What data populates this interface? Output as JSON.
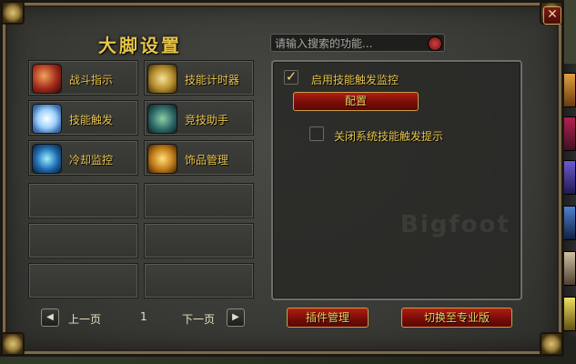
{
  "window": {
    "title": "大脚设置",
    "close_label": "✕"
  },
  "search": {
    "placeholder": "请输入搜索的功能..."
  },
  "modules": [
    {
      "label": "战斗指示",
      "icon": "sword-icon"
    },
    {
      "label": "技能计时器",
      "icon": "timer-icon"
    },
    {
      "label": "技能触发",
      "icon": "spell-trigger-icon"
    },
    {
      "label": "竞技助手",
      "icon": "arena-icon"
    },
    {
      "label": "冷却监控",
      "icon": "cooldown-orb-icon"
    },
    {
      "label": "饰品管理",
      "icon": "trinket-icon"
    }
  ],
  "pager": {
    "prev_label": "上一页",
    "page_number": "1",
    "next_label": "下一页"
  },
  "options": {
    "enable_label": "启用技能触发监控",
    "enable_checked": true,
    "config_label": "配置",
    "disable_label": "关闭系统技能触发提示",
    "disable_checked": false
  },
  "footer": {
    "addon_manage_label": "插件管理",
    "switch_pro_label": "切换至专业版"
  },
  "colors": {
    "title_gold": "#e6c64a",
    "label_gold": "#e7c44c",
    "button_red": "#b01e14"
  }
}
